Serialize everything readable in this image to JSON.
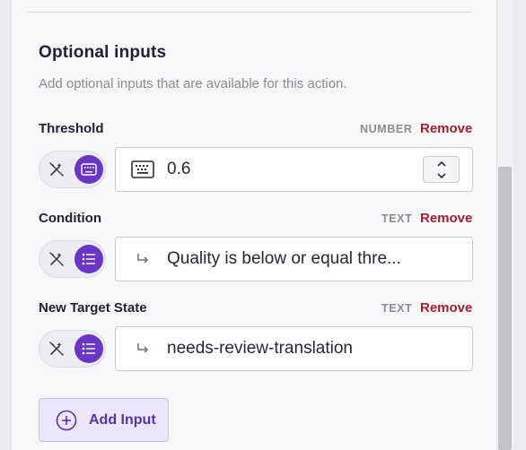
{
  "section": {
    "title": "Optional inputs",
    "description": "Add optional inputs that are available for this action."
  },
  "inputs": [
    {
      "label": "Threshold",
      "type": "NUMBER",
      "remove": "Remove",
      "value": "0.6",
      "mode_icon": "keyboard-icon",
      "prefix_icon": "keyboard-icon"
    },
    {
      "label": "Condition",
      "type": "TEXT",
      "remove": "Remove",
      "value": "Quality is below or equal thre...",
      "mode_icon": "list-icon",
      "prefix_icon": "return-arrow-icon"
    },
    {
      "label": "New Target State",
      "type": "TEXT",
      "remove": "Remove",
      "value": "needs-review-translation",
      "mode_icon": "list-icon",
      "prefix_icon": "return-arrow-icon"
    }
  ],
  "add_input": {
    "label": "Add Input",
    "icon": "plus-circle-icon"
  },
  "colors": {
    "accent": "#6a36c6",
    "remove": "#a51e2c",
    "button_bg": "#ece6fa"
  }
}
